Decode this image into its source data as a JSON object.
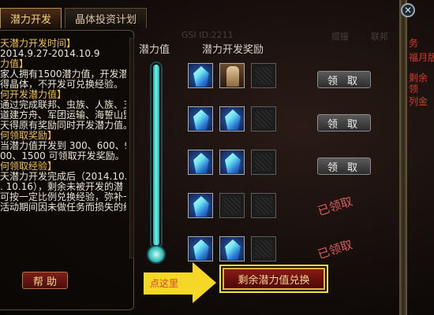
{
  "tabs": [
    {
      "label": "潜力开发",
      "active": true
    },
    {
      "label": "晶体投资计划",
      "active": false
    }
  ],
  "left": {
    "lines": [
      {
        "text": "天潜力开发时间】",
        "style": "h"
      },
      {
        "text": "2014.9.27-2014.10.9",
        "style": "b"
      },
      {
        "text": "力值】",
        "style": "h"
      },
      {
        "text": "家人拥有1500潜力值，开发潜力",
        "style": "b"
      },
      {
        "text": "得晶体，不开发可兑换经验。",
        "style": "b"
      },
      {
        "text": "何开发潜力值】",
        "style": "h"
      },
      {
        "text": "通过完成联邦、虫族、人族、五",
        "style": "b"
      },
      {
        "text": "道建方舟、军团运输、海誓山盟",
        "style": "b"
      },
      {
        "text": "天得原有奖励同时开发潜力值。",
        "style": "b"
      },
      {
        "text": "何领取奖励】",
        "style": "h"
      },
      {
        "text": "当潜力值开发到 300、600、900",
        "style": "b"
      },
      {
        "text": "00、1500 可领取开发奖励。",
        "style": "b"
      },
      {
        "text": "何领取经验】",
        "style": "h"
      },
      {
        "text": "天潜力开发完成后（2014.10.10",
        "style": "b"
      },
      {
        "text": ". 10.16），剩余未被开发的潜",
        "style": "b"
      },
      {
        "text": "可按一定比例兑换经验，弥补一",
        "style": "b"
      },
      {
        "text": "活动期间因未做任务而损失的经",
        "style": "b"
      }
    ],
    "help_label": "帮 助"
  },
  "headers": {
    "potential": "潜力值",
    "reward": "潜力开发奖励"
  },
  "ghost": {
    "a": "GSI ID:2211",
    "b": "提撞",
    "c": "联邦"
  },
  "rows": [
    {
      "slots": [
        "crystal",
        "char",
        "empty"
      ],
      "action": "button",
      "label": "领 取"
    },
    {
      "slots": [
        "crystal",
        "crystal",
        "empty"
      ],
      "action": "button",
      "label": "领 取"
    },
    {
      "slots": [
        "crystal",
        "crystal",
        "empty"
      ],
      "action": "button",
      "label": "领 取"
    },
    {
      "slots": [
        "crystal",
        "empty",
        "empty"
      ],
      "action": "claimed",
      "label": "已领取"
    },
    {
      "slots": [
        "crystal",
        "crystal",
        "empty"
      ],
      "action": "claimed",
      "label": "已领取"
    }
  ],
  "exchange": {
    "label": "剩余潜力值兑换"
  },
  "annotation": {
    "text": "点这里"
  },
  "side": [
    "务",
    "福月版",
    "剩余",
    "领",
    "列金"
  ],
  "colors": {
    "accent": "#f5d726",
    "claimed_red": "#d95d5d",
    "button_red": "#8a1a17"
  }
}
